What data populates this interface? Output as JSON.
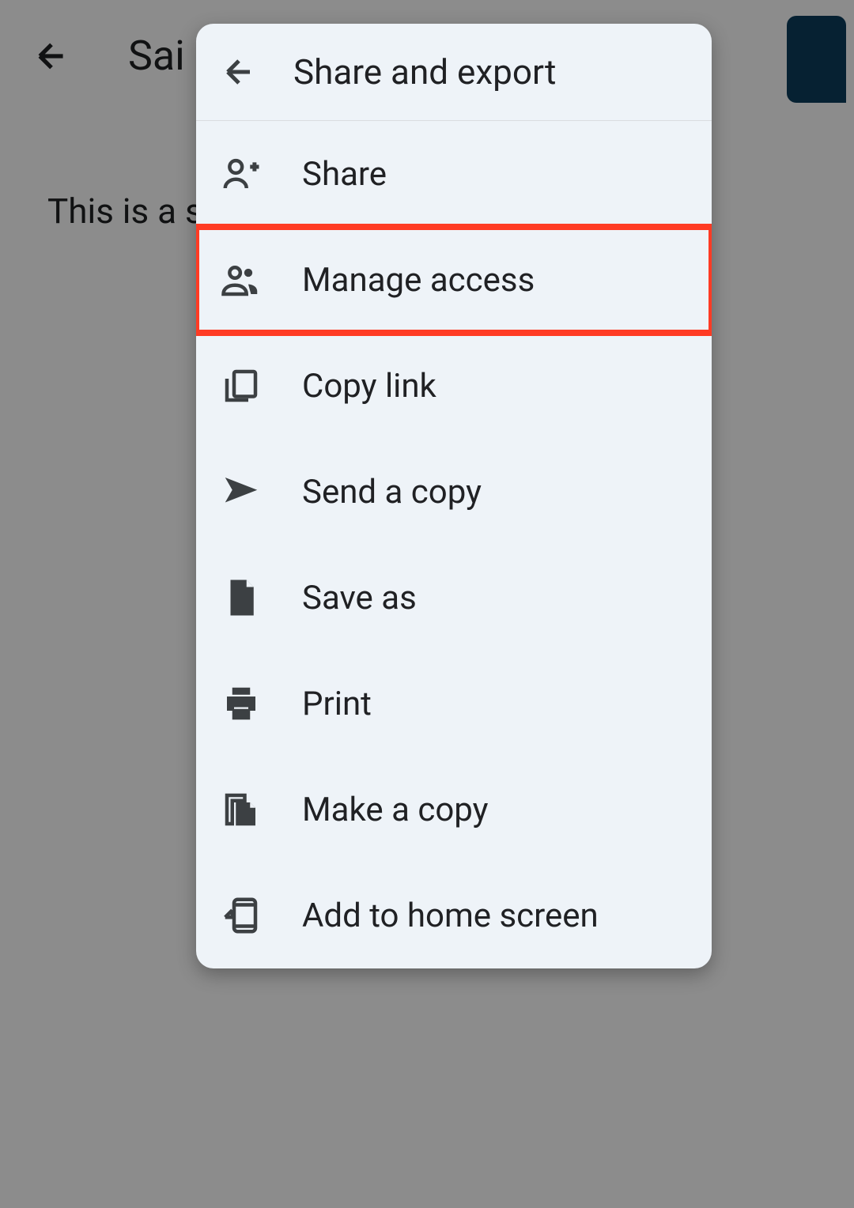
{
  "background": {
    "title": "Sai",
    "body_text": "This is a sa"
  },
  "menu": {
    "title": "Share and export",
    "items": [
      {
        "icon": "person-add-icon",
        "label": "Share"
      },
      {
        "icon": "people-icon",
        "label": "Manage access",
        "highlighted": true
      },
      {
        "icon": "copy-link-icon",
        "label": "Copy link"
      },
      {
        "icon": "send-icon",
        "label": "Send a copy"
      },
      {
        "icon": "file-icon",
        "label": "Save as"
      },
      {
        "icon": "print-icon",
        "label": "Print"
      },
      {
        "icon": "file-copy-icon",
        "label": "Make a copy"
      },
      {
        "icon": "add-home-icon",
        "label": "Add to home screen"
      }
    ]
  }
}
